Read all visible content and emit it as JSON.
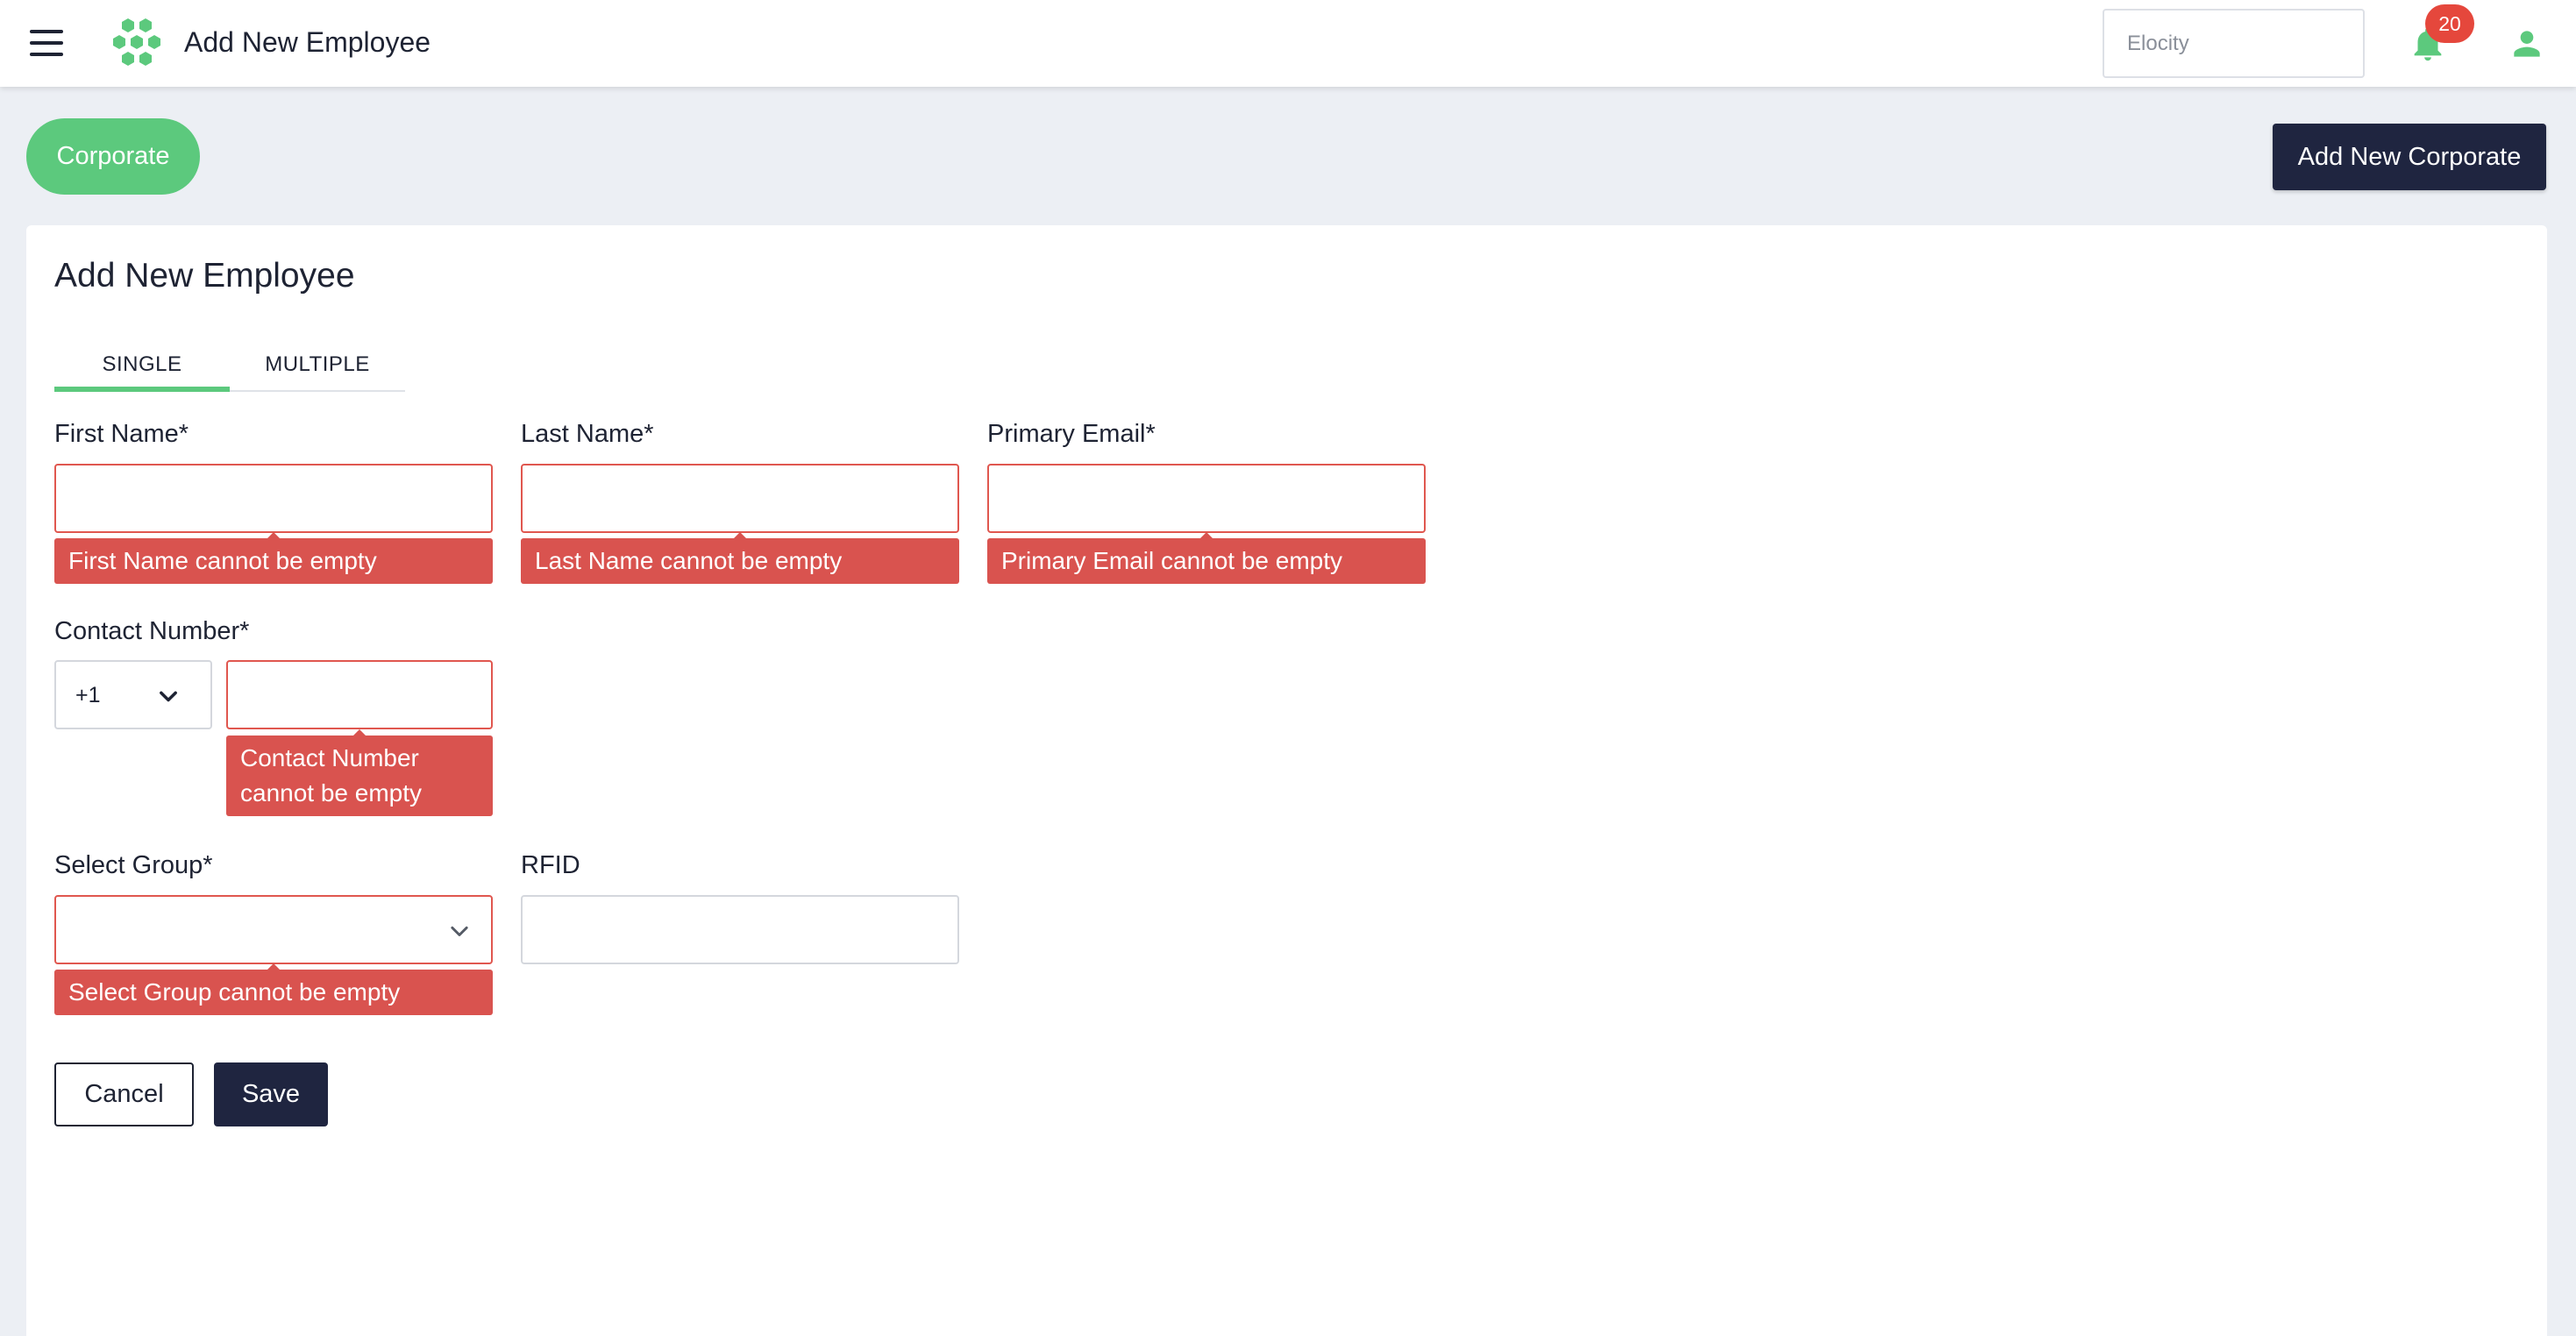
{
  "header": {
    "title": "Add New Employee",
    "search_placeholder": "Elocity",
    "notification_count": "20"
  },
  "corporate": {
    "pill_label": "Corporate",
    "add_button_label": "Add New Corporate"
  },
  "form": {
    "title": "Add New Employee",
    "tabs": [
      {
        "label": "SINGLE",
        "active": true
      },
      {
        "label": "MULTIPLE",
        "active": false
      }
    ],
    "fields": {
      "first_name": {
        "label": "First Name*",
        "value": "",
        "error": "First Name cannot be empty"
      },
      "last_name": {
        "label": "Last Name*",
        "value": "",
        "error": "Last Name cannot be empty"
      },
      "primary_email": {
        "label": "Primary Email*",
        "value": "",
        "error": "Primary Email cannot be empty"
      },
      "contact_number": {
        "label": "Contact Number*",
        "country_code": "+1",
        "value": "",
        "error_line1": "Contact Number",
        "error_line2": "cannot be empty"
      },
      "select_group": {
        "label": "Select Group*",
        "value": "",
        "error": "Select Group cannot be empty"
      },
      "rfid": {
        "label": "RFID",
        "value": ""
      }
    },
    "buttons": {
      "cancel": "Cancel",
      "save": "Save"
    }
  },
  "colors": {
    "accent_green": "#5cc97d",
    "navy": "#1f2540",
    "error_red": "#d9534f",
    "badge_red": "#e5473c"
  }
}
